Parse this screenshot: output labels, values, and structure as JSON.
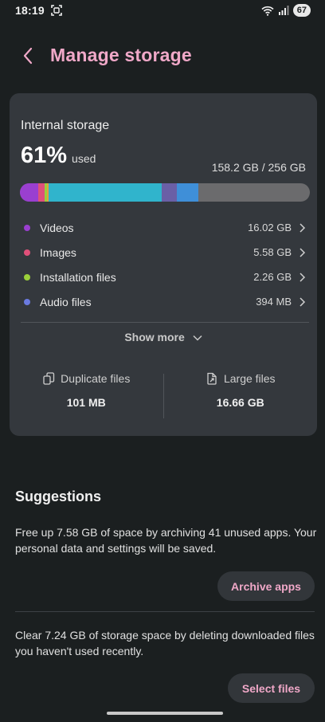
{
  "status_bar": {
    "time": "18:19",
    "battery": "67"
  },
  "header": {
    "title": "Manage storage"
  },
  "storage": {
    "label": "Internal storage",
    "percent": "61%",
    "used_label": "used",
    "capacity": "158.2 GB / 256 GB",
    "bar_segments": [
      {
        "name": "videos",
        "fraction": 0.063,
        "color": "#9a3fd0"
      },
      {
        "name": "images",
        "fraction": 0.022,
        "color": "#e0507a"
      },
      {
        "name": "installation",
        "fraction": 0.009,
        "color": "#9bd03a"
      },
      {
        "name": "gap",
        "fraction": 0.004,
        "color": "#e2a040"
      },
      {
        "name": "apps",
        "fraction": 0.39,
        "color": "#30b4cc"
      },
      {
        "name": "audio",
        "fraction": 0.052,
        "color": "#6a5fa6"
      },
      {
        "name": "other",
        "fraction": 0.075,
        "color": "#3f8fd8"
      }
    ],
    "free_color": "#6b6b6d"
  },
  "categories": [
    {
      "name": "Videos",
      "size": "16.02 GB",
      "color": "#9a3fd0"
    },
    {
      "name": "Images",
      "size": "5.58 GB",
      "color": "#e0507a"
    },
    {
      "name": "Installation files",
      "size": "2.26 GB",
      "color": "#9bd03a"
    },
    {
      "name": "Audio files",
      "size": "394 MB",
      "color": "#6a7ae0"
    }
  ],
  "show_more": "Show more",
  "stats": {
    "duplicate": {
      "label": "Duplicate files",
      "value": "101 MB"
    },
    "large": {
      "label": "Large files",
      "value": "16.66 GB"
    }
  },
  "suggestions": {
    "title": "Suggestions",
    "items": [
      {
        "text": "Free up 7.58 GB of space by archiving 41 unused apps. Your personal data and settings will be saved.",
        "button": "Archive apps"
      },
      {
        "text": "Clear 7.24 GB of storage space by deleting downloaded files you haven't used recently.",
        "button": "Select files"
      }
    ]
  },
  "colors": {
    "accent": "#f0a8c8",
    "background": "#1b1f20",
    "card": "#34383d"
  }
}
